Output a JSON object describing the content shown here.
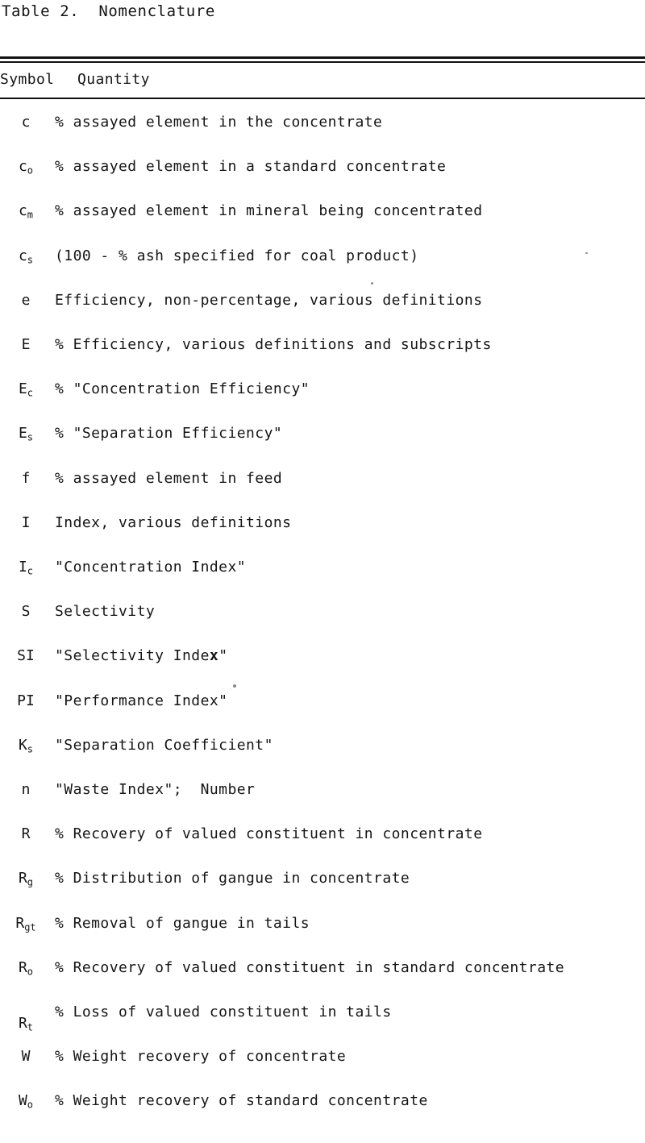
{
  "title": "Table 2.  Nomenclature",
  "columns": {
    "symbol": "Symbol",
    "quantity": "Quantity"
  },
  "rows": [
    {
      "symbol": "c",
      "sub": "",
      "quantity": "% assayed element in the concentrate"
    },
    {
      "symbol": "c",
      "sub": "o",
      "quantity": "% assayed element in a standard concentrate"
    },
    {
      "symbol": "c",
      "sub": "m",
      "quantity": "% assayed element in mineral being concentrated"
    },
    {
      "symbol": "c",
      "sub": "s",
      "quantity": "(100 - % ash specified for coal product)"
    },
    {
      "symbol": "e",
      "sub": "",
      "quantity": "Efficiency, non-percentage, various definitions"
    },
    {
      "symbol": "E",
      "sub": "",
      "quantity": "% Efficiency, various definitions and subscripts"
    },
    {
      "symbol": "E",
      "sub": "c",
      "quantity": "% \"Concentration Efficiency\""
    },
    {
      "symbol": "E",
      "sub": "s",
      "quantity": "% \"Separation Efficiency\""
    },
    {
      "symbol": "f",
      "sub": "",
      "quantity": "% assayed element in feed"
    },
    {
      "symbol": "I",
      "sub": "",
      "quantity": "Index, various definitions"
    },
    {
      "symbol": "I",
      "sub": "c",
      "quantity": "\"Concentration Index\""
    },
    {
      "symbol": "S",
      "sub": "",
      "quantity": "Selectivity"
    },
    {
      "symbol": "SI",
      "sub": "",
      "quantity": "\"Selectivity Index\""
    },
    {
      "symbol": "PI",
      "sub": "",
      "quantity": "\"Performance Index\""
    },
    {
      "symbol": "K",
      "sub": "s",
      "quantity": "\"Separation Coefficient\""
    },
    {
      "symbol": "n",
      "sub": "",
      "quantity": "\"Waste Index\";  Number"
    },
    {
      "symbol": "R",
      "sub": "",
      "quantity": "% Recovery of valued constituent in concentrate"
    },
    {
      "symbol": "R",
      "sub": "g",
      "quantity": "% Distribution of gangue in concentrate"
    },
    {
      "symbol": "R",
      "sub": "gt",
      "quantity": "% Removal of gangue in tails"
    },
    {
      "symbol": "R",
      "sub": "o",
      "quantity": "% Recovery of valued constituent in standard concentrate"
    },
    {
      "symbol": "R",
      "sub": "t",
      "quantity": "% Loss of valued constituent in tails"
    },
    {
      "symbol": "W",
      "sub": "",
      "quantity": "% Weight recovery of concentrate"
    },
    {
      "symbol": "W",
      "sub": "o",
      "quantity": "% Weight recovery of standard concentrate"
    }
  ]
}
